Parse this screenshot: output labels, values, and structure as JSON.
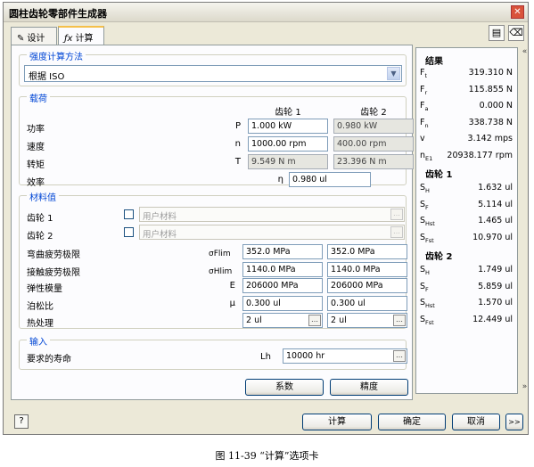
{
  "window": {
    "title": "圆柱齿轮零部件生成器",
    "close_glyph": "✕"
  },
  "tabs": [
    {
      "label": "设计",
      "icon": "pencil-icon"
    },
    {
      "label": "计算",
      "icon": "formula-icon"
    }
  ],
  "method": {
    "title": "强度计算方法",
    "value": "根据 ISO"
  },
  "loads": {
    "title": "载荷",
    "col1": "齿轮 1",
    "col2": "齿轮 2",
    "rows": [
      {
        "label": "功率",
        "sym": "P",
        "v1": "1.000 kW",
        "v2": "0.980 kW"
      },
      {
        "label": "速度",
        "sym": "n",
        "v1": "1000.00 rpm",
        "v2": "400.00 rpm"
      },
      {
        "label": "转矩",
        "sym": "T",
        "v1": "9.549 N m",
        "v2": "23.396 N m"
      }
    ],
    "eff": {
      "label": "效率",
      "sym": "η",
      "value": "0.980 ul"
    }
  },
  "materials": {
    "title": "材料值",
    "gear1": {
      "label": "齿轮 1",
      "value": "用户材料"
    },
    "gear2": {
      "label": "齿轮 2",
      "value": "用户材料"
    },
    "rows": [
      {
        "label": "弯曲疲劳极限",
        "sym": "σFlim",
        "v1": "352.0 MPa",
        "v2": "352.0 MPa"
      },
      {
        "label": "接触疲劳极限",
        "sym": "σHlim",
        "v1": "1140.0 MPa",
        "v2": "1140.0 MPa"
      },
      {
        "label": "弹性模量",
        "sym": "E",
        "v1": "206000 MPa",
        "v2": "206000 MPa"
      },
      {
        "label": "泊松比",
        "sym": "μ",
        "v1": "0.300 ul",
        "v2": "0.300 ul"
      }
    ],
    "heat": {
      "label": "热处理",
      "v1": "2 ul",
      "v2": "2 ul"
    }
  },
  "input": {
    "title": "输入",
    "life_label": "要求的寿命",
    "life_sym": "Lh",
    "life_value": "10000 hr"
  },
  "buttons": {
    "factors": "系数",
    "accuracy": "精度",
    "calculate": "计算",
    "ok": "确定",
    "cancel": "取消",
    "more": ">>",
    "help": "?"
  },
  "results": {
    "title": "结果",
    "main": [
      {
        "s": "F",
        "sub": "t",
        "v": "319.310 N"
      },
      {
        "s": "F",
        "sub": "r",
        "v": "115.855 N"
      },
      {
        "s": "F",
        "sub": "a",
        "v": "0.000 N"
      },
      {
        "s": "F",
        "sub": "n",
        "v": "338.738 N"
      },
      {
        "s": "v",
        "sub": "",
        "v": "3.142 mps"
      },
      {
        "s": "n",
        "sub": "E1",
        "v": "20938.177 rpm"
      }
    ],
    "g1_title": "齿轮 1",
    "g1": [
      {
        "s": "S",
        "sub": "H",
        "v": "1.632 ul"
      },
      {
        "s": "S",
        "sub": "F",
        "v": "5.114 ul"
      },
      {
        "s": "S",
        "sub": "Hst",
        "v": "1.465 ul"
      },
      {
        "s": "S",
        "sub": "Fst",
        "v": "10.970 ul"
      }
    ],
    "g2_title": "齿轮 2",
    "g2": [
      {
        "s": "S",
        "sub": "H",
        "v": "1.749 ul"
      },
      {
        "s": "S",
        "sub": "F",
        "v": "5.859 ul"
      },
      {
        "s": "S",
        "sub": "Hst",
        "v": "1.570 ul"
      },
      {
        "s": "S",
        "sub": "Fst",
        "v": "12.449 ul"
      }
    ]
  },
  "caption": "图 11-39 “计算”选项卡"
}
